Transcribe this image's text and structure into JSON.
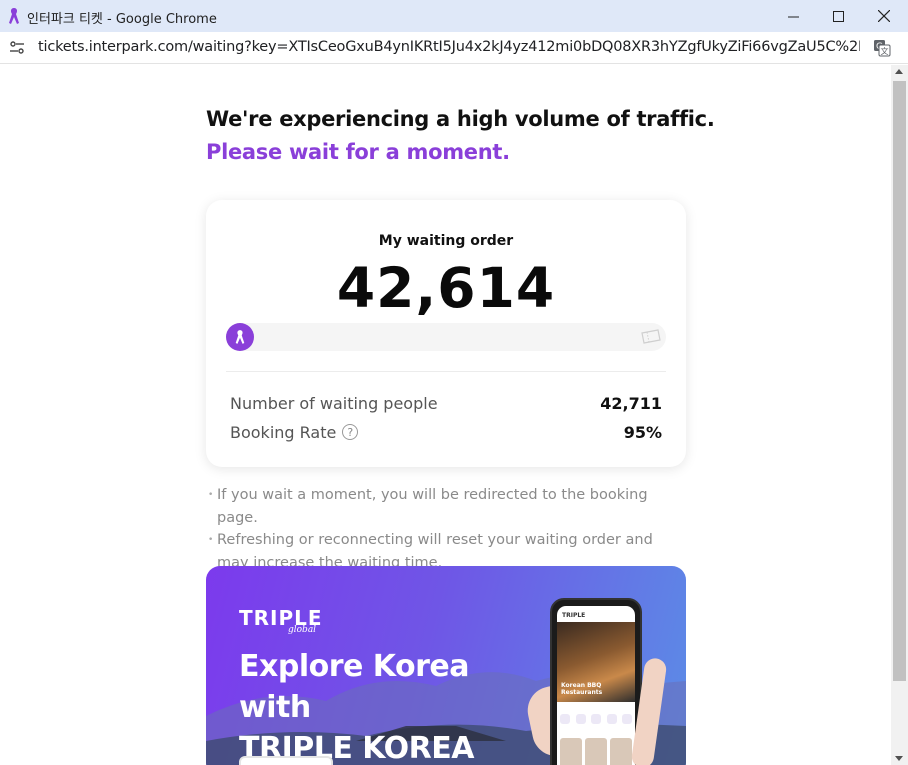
{
  "window": {
    "title": "인터파크 티켓 - Google Chrome"
  },
  "address_bar": {
    "url": "tickets.interpark.com/waiting?key=XTIsCeoGxuB4ynIKRtI5Ju4x2kJ4yz412mi0bDQ08XR3hYZgfUkyZiFi66vgZaU5C%2FtIE4yp..."
  },
  "page": {
    "headline": "We're experiencing a high volume of traffic.",
    "subhead": "Please wait for a moment.",
    "accent_color": "#8a3fd9"
  },
  "waiting_card": {
    "order_label": "My waiting order",
    "order_number": "42,614",
    "progress_fraction": 0.0,
    "stats": [
      {
        "label": "Number of waiting people",
        "value": "42,711"
      },
      {
        "label": "Booking Rate",
        "value": "95%"
      }
    ],
    "help_glyph": "?"
  },
  "notes": [
    "If you wait a moment, you will be redirected to the booking page.",
    "Refreshing or reconnecting will reset your waiting order and may increase the waiting time."
  ],
  "banner": {
    "brand": "TRIPLE",
    "brand_sub": "global",
    "title_line1": "Explore Korea with",
    "title_line2": "TRIPLE KOREA",
    "phone_app_name": "TRIPLE",
    "phone_food_label": "Korean BBQ Restaurants"
  },
  "icons": {
    "app": "interpark-logo-icon",
    "site_info": "site-info-icon",
    "translate": "translate-icon",
    "ticket": "ticket-icon"
  }
}
